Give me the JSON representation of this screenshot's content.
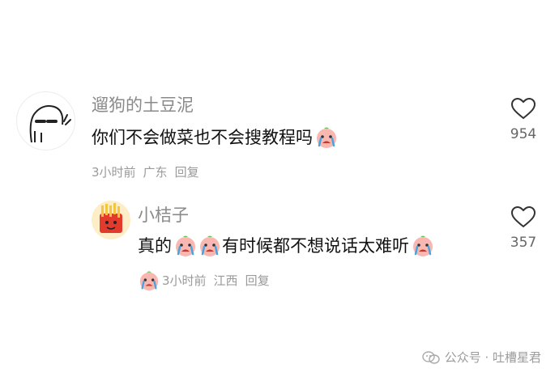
{
  "comments": [
    {
      "username": "遛狗的土豆泥",
      "text": "你们不会做菜也不会搜教程吗",
      "meta": {
        "time": "3小时前",
        "location": "广东",
        "reply": "回复"
      },
      "likes": "954"
    }
  ],
  "reply": {
    "username": "小桔子",
    "text_before": "真的",
    "text_middle": "有时候都不想说话太难听",
    "meta": {
      "time": "3小时前",
      "location": "江西",
      "reply": "回复"
    },
    "likes": "357"
  },
  "watermark": {
    "text": "公众号 · 吐槽星君"
  },
  "icons": [
    "heart-outline-icon",
    "crying-emoji-icon",
    "wechat-logo-icon"
  ],
  "colors": {
    "text": "#111111",
    "username": "#8a8a8a",
    "meta": "#9a9a9a",
    "emoji_face": "#f8b7b0"
  }
}
